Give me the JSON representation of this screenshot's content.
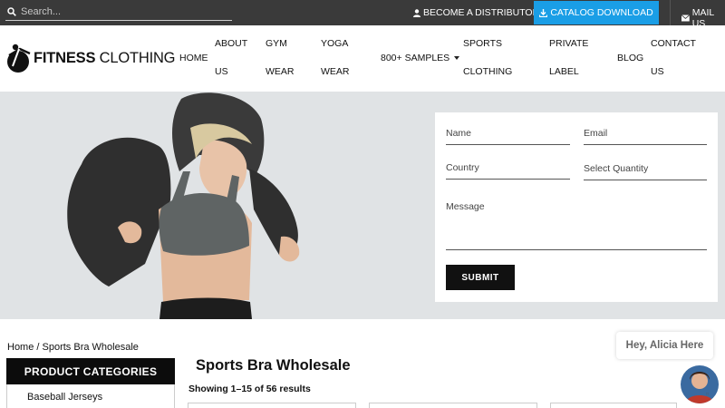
{
  "topbar": {
    "search_placeholder": "Search...",
    "distributor_label": "BECOME A DISTRIBUTOR",
    "catalog_label": "CATALOG DOWNLOAD",
    "mail_label": "MAIL US",
    "icons": [
      "search-icon",
      "user-icon",
      "download-icon",
      "mail-icon"
    ]
  },
  "brand": {
    "logo_bold": "FITNESS",
    "logo_rest": " CLOTHING"
  },
  "nav": {
    "home": "HOME",
    "about_1": "ABOUT",
    "about_2": "US",
    "gym_1": "GYM",
    "gym_2": "WEAR",
    "yoga_1": "YOGA",
    "yoga_2": "WEAR",
    "samples": "800+ SAMPLES",
    "sports_1": "SPORTS",
    "sports_2": "CLOTHING",
    "private_1": "PRIVATE",
    "private_2": "LABEL",
    "blog": "BLOG",
    "contact_1": "CONTACT",
    "contact_2": "US"
  },
  "form": {
    "name_placeholder": "Name",
    "email_placeholder": "Email",
    "country_placeholder": "Country",
    "quantity_placeholder": "Select Quantity",
    "message_placeholder": "Message",
    "submit_label": "SUBMIT"
  },
  "breadcrumb": {
    "home": "Home",
    "separator": " / ",
    "current": "Sports Bra Wholesale"
  },
  "chat": {
    "greeting": "Hey, Alicia Here"
  },
  "sidebar": {
    "heading": "PRODUCT CATEGORIES",
    "items": [
      "Baseball Jerseys"
    ]
  },
  "main": {
    "title": "Sports Bra Wholesale",
    "result_count": "Showing 1–15 of 56 results"
  },
  "colors": {
    "topbar_bg": "#3a3a3a",
    "catalog_button": "#1a9ee6",
    "hero_bg": "#e0e3e5",
    "dark_button": "#111111"
  }
}
